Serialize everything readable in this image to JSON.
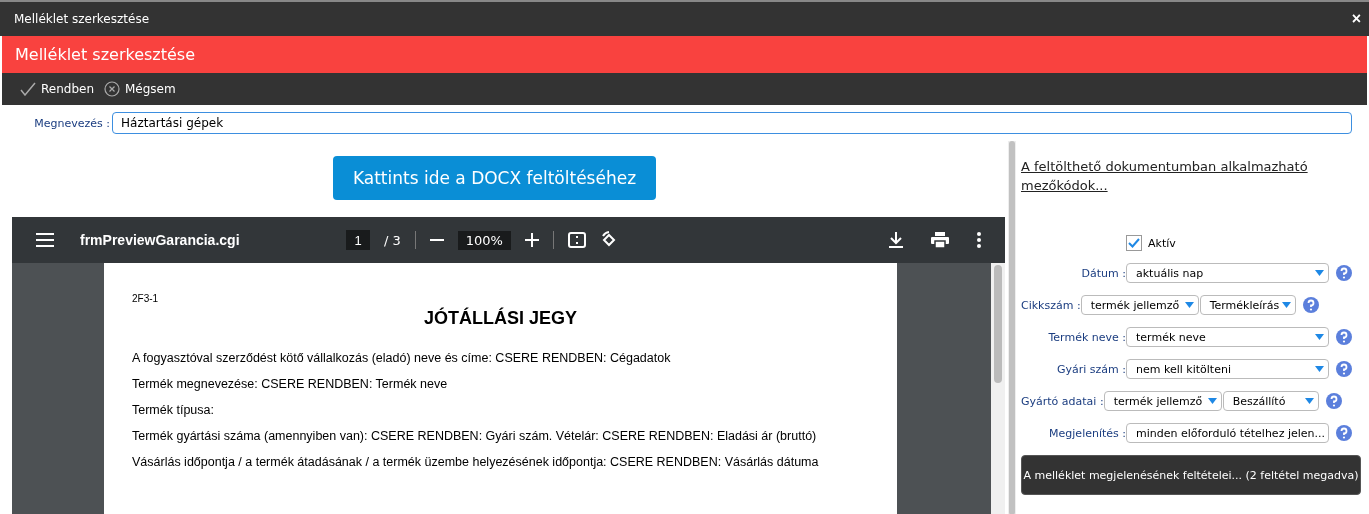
{
  "window": {
    "title": "Melléklet szerkesztése",
    "close": "×"
  },
  "header": {
    "title": "Melléklet szerkesztése"
  },
  "toolbar": [
    {
      "kind": "ok",
      "label": "Rendben"
    },
    {
      "kind": "cancel",
      "label": "Mégsem"
    }
  ],
  "name_field": {
    "label": "Megnevezés :",
    "value": "Háztartási gépek"
  },
  "upload_button": "Kattints ide a DOCX feltöltéséhez",
  "pdf_viewer": {
    "filename": "frmPreviewGarancia.cgi",
    "page": "1",
    "pages": "/ 3",
    "zoom": "100%",
    "document": {
      "code": "2F3-1",
      "title": "JÓTÁLLÁSI JEGY",
      "lines": [
        "A fogyasztóval szerződést kötő vállalkozás (eladó) neve és címe: CSERE RENDBEN: Cégadatok",
        "Termék megnevezése:  CSERE RENDBEN: Termék neve",
        "Termék típusa:",
        "Termék gyártási száma (amennyiben van):  CSERE RENDBEN: Gyári szám. Vételár: CSERE RENDBEN: Eladási ár (bruttó)",
        "Vásárlás időpontja / a termék átadásának / a termék üzembe helyezésének időpontja:  CSERE RENDBEN: Vásárlás dátuma"
      ]
    }
  },
  "side": {
    "codes_link": "A feltölthető dokumentumban alkalmazható mezőkódok...",
    "active": {
      "label": "Aktív",
      "checked": true
    },
    "fields": [
      {
        "label": "Dátum :",
        "selects": [
          "aktuális nap"
        ]
      },
      {
        "label": "Cikkszám :",
        "selects": [
          "termék jellemző",
          "Termékleírás"
        ]
      },
      {
        "label": "Termék neve :",
        "selects": [
          "termék neve"
        ]
      },
      {
        "label": "Gyári szám :",
        "selects": [
          "nem kell kitölteni"
        ]
      },
      {
        "label": "Gyártó adatai :",
        "selects": [
          "termék jellemző",
          "Beszállító"
        ]
      },
      {
        "label": "Megjelenítés :",
        "selects": [
          "minden előforduló tételhez jelen..."
        ]
      }
    ],
    "conditions_button": "A melléklet megjelenésének feltételei... (2 feltétel megadva)"
  }
}
